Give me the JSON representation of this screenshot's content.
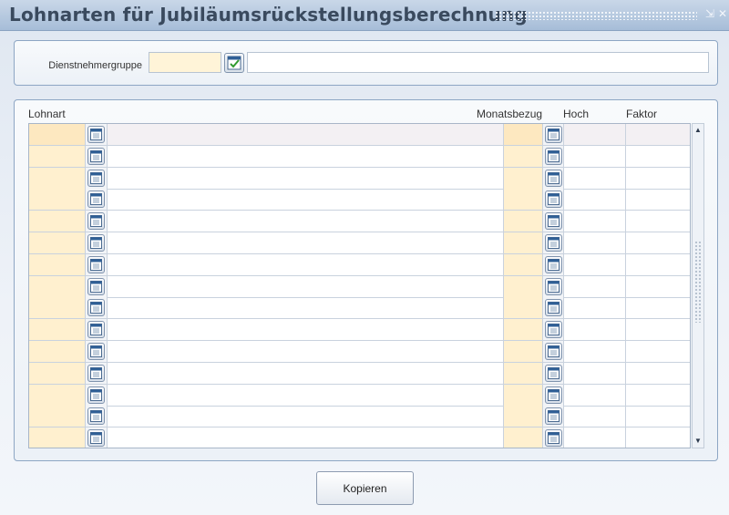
{
  "window": {
    "title": "Lohnarten für Jubiläumsrückstellungsberechnung",
    "pin_glyph": "⇲",
    "close_glyph": "✕"
  },
  "header": {
    "dienstnehmergruppe_label": "Dienstnehmergruppe",
    "code_value": "",
    "description_value": ""
  },
  "grid": {
    "columns": {
      "lohnart": "Lohnart",
      "monatsbezug": "Monatsbezug",
      "hoch": "Hoch",
      "faktor": "Faktor"
    },
    "rows": [
      {
        "lohnart": "",
        "bezeichnung": "",
        "monatsbezug": "",
        "hoch": "",
        "faktor": ""
      },
      {
        "lohnart": "",
        "bezeichnung": "",
        "monatsbezug": "",
        "hoch": "",
        "faktor": ""
      },
      {
        "lohnart": "",
        "bezeichnung": "",
        "monatsbezug": "",
        "hoch": "",
        "faktor": ""
      },
      {
        "lohnart": "",
        "bezeichnung": "",
        "monatsbezug": "",
        "hoch": "",
        "faktor": ""
      },
      {
        "lohnart": "",
        "bezeichnung": "",
        "monatsbezug": "",
        "hoch": "",
        "faktor": ""
      },
      {
        "lohnart": "",
        "bezeichnung": "",
        "monatsbezug": "",
        "hoch": "",
        "faktor": ""
      },
      {
        "lohnart": "",
        "bezeichnung": "",
        "monatsbezug": "",
        "hoch": "",
        "faktor": ""
      },
      {
        "lohnart": "",
        "bezeichnung": "",
        "monatsbezug": "",
        "hoch": "",
        "faktor": ""
      },
      {
        "lohnart": "",
        "bezeichnung": "",
        "monatsbezug": "",
        "hoch": "",
        "faktor": ""
      },
      {
        "lohnart": "",
        "bezeichnung": "",
        "monatsbezug": "",
        "hoch": "",
        "faktor": ""
      },
      {
        "lohnart": "",
        "bezeichnung": "",
        "monatsbezug": "",
        "hoch": "",
        "faktor": ""
      },
      {
        "lohnart": "",
        "bezeichnung": "",
        "monatsbezug": "",
        "hoch": "",
        "faktor": ""
      },
      {
        "lohnart": "",
        "bezeichnung": "",
        "monatsbezug": "",
        "hoch": "",
        "faktor": ""
      },
      {
        "lohnart": "",
        "bezeichnung": "",
        "monatsbezug": "",
        "hoch": "",
        "faktor": ""
      },
      {
        "lohnart": "",
        "bezeichnung": "",
        "monatsbezug": "",
        "hoch": "",
        "faktor": ""
      }
    ]
  },
  "footer": {
    "kopieren_label": "Kopieren"
  },
  "icons": {
    "header_lookup": "calendar-check-icon",
    "row_lookup": "list-calendar-icon",
    "close": "close-icon",
    "pin": "pin-icon"
  },
  "colors": {
    "required_field": "#fff0cf",
    "title_text": "#3a4a5e",
    "titlebar": "#a6bdd8"
  }
}
